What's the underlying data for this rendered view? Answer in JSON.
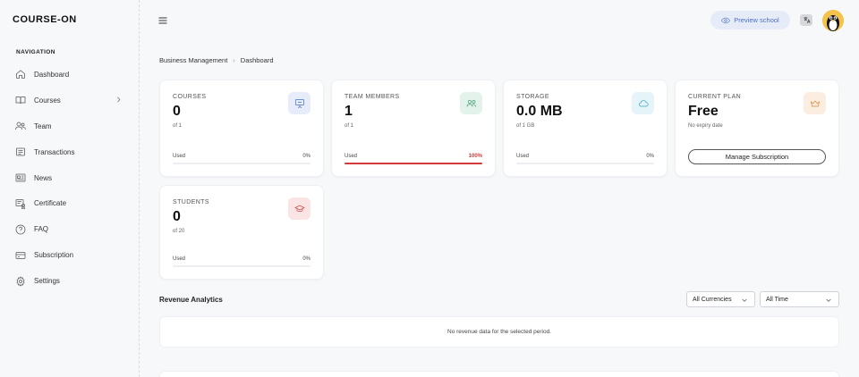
{
  "app": {
    "logo": "COURSE-ON"
  },
  "sidebar": {
    "section_title": "NAVIGATION",
    "items": [
      {
        "label": "Dashboard",
        "icon": "home-icon"
      },
      {
        "label": "Courses",
        "icon": "book-icon"
      },
      {
        "label": "Team",
        "icon": "users-icon"
      },
      {
        "label": "Transactions",
        "icon": "receipt-icon"
      },
      {
        "label": "News",
        "icon": "newspaper-icon"
      },
      {
        "label": "Certificate",
        "icon": "certificate-icon"
      },
      {
        "label": "FAQ",
        "icon": "help-circle-icon"
      },
      {
        "label": "Subscription",
        "icon": "card-icon"
      },
      {
        "label": "Settings",
        "icon": "gear-icon"
      }
    ]
  },
  "topbar": {
    "preview_label": "Preview school"
  },
  "breadcrumb": {
    "parent": "Business Management",
    "current": "Dashboard"
  },
  "cards": {
    "courses": {
      "title": "COURSES",
      "value": "0",
      "sub": "of 1",
      "used_label": "Used",
      "percent": "0%",
      "fill": 0
    },
    "team": {
      "title": "TEAM MEMBERS",
      "value": "1",
      "sub": "of 1",
      "used_label": "Used",
      "percent": "100%",
      "fill": 100
    },
    "storage": {
      "title": "STORAGE",
      "value": "0.0 MB",
      "sub": "of 1 GB",
      "used_label": "Used",
      "percent": "0%",
      "fill": 0
    },
    "plan": {
      "title": "CURRENT PLAN",
      "value": "Free",
      "sub": "No expiry date",
      "button": "Manage Subscription"
    },
    "students": {
      "title": "STUDENTS",
      "value": "0",
      "sub": "of 20",
      "used_label": "Used",
      "percent": "0%",
      "fill": 0
    }
  },
  "revenue": {
    "title": "Revenue Analytics",
    "currency_select": "All Currencies",
    "period_select": "All Time",
    "empty_message": "No revenue data for the selected period."
  },
  "colors": {
    "accent": "#4a6fc7",
    "danger": "#d33a3a"
  }
}
